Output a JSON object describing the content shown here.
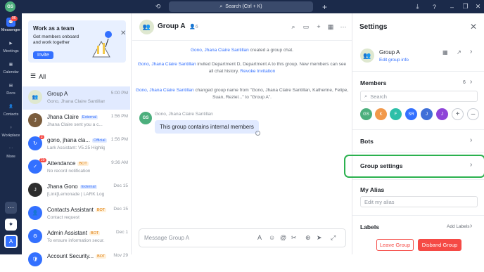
{
  "topbar": {
    "avatar": "GS",
    "search": "Search (Ctrl + K)"
  },
  "nav": {
    "messenger": "Messenger",
    "messenger_badge": "96",
    "meetings": "Meetings",
    "calendar": "Calendar",
    "docs": "Docs",
    "contacts": "Contacts",
    "workplace": "Workplace",
    "more": "More",
    "bottom_avatar": "A"
  },
  "banner": {
    "title": "Work as a team",
    "subtitle": "Get members onboard and work together",
    "invite": "Invite"
  },
  "list_filter": "All",
  "chats": [
    {
      "name": "Group A",
      "time": "5:00 PM",
      "sub": "Gono, Jhana Claire Santillan"
    },
    {
      "name": "Jhana Claire",
      "tag": "External",
      "time": "1:56 PM",
      "sub": "Jhana Claire sent you a c..."
    },
    {
      "name": "gono, jhana cla...",
      "tag": "Official",
      "time": "1:56 PM",
      "sub": "Lark Assistant: V5.25 Highlig...",
      "badge": "2"
    },
    {
      "name": "Attendance",
      "tag": "BOT",
      "time": "9:36 AM",
      "sub": "No record notification",
      "badge": "29"
    },
    {
      "name": "Jhana Gono",
      "tag": "External",
      "time": "Dec 15",
      "sub": "[Link]Lemonade | LARK Log ..."
    },
    {
      "name": "Contacts Assistant",
      "tag": "BOT",
      "time": "Dec 15",
      "sub": "Contact request"
    },
    {
      "name": "Admin Assistant",
      "tag": "BOT",
      "time": "Dec 1",
      "sub": "To ensure information secur..."
    },
    {
      "name": "Account Security...",
      "tag": "BOT",
      "time": "Nov 29",
      "sub": ""
    }
  ],
  "chat": {
    "title": "Group A",
    "member_count": "6",
    "sys1_link": "Gono, Jhana Claire Santillan",
    "sys1_text": " created a group chat.",
    "sys2_link": "Gono, Jhana Claire Santillan",
    "sys2_text_a": " invited Department D, Department A to this group. New members can see",
    "sys2_text_b": "all chat history. ",
    "sys2_revoke": "Revoke Invitation",
    "sys3_link": "Gono, Jhana Claire Santillan",
    "sys3_text_a": " changed group name from \"Gono, Jhana Claire Santillan, Katherine, Felipe,",
    "sys3_text_b": "Suan, Reziel...\" to \"Group A\".",
    "msg_avatar": "GS",
    "msg_sender": "Gono, Jhana Claire Santillan",
    "msg_text": "This group contains internal members",
    "composer_placeholder": "Message Group A"
  },
  "settings": {
    "title": "Settings",
    "group_name": "Group A",
    "edit_info": "Edit group info",
    "members_label": "Members",
    "members_count": "6",
    "members_search": "Search",
    "member_avatars": [
      {
        "initials": "GS",
        "color": "#4caf7d"
      },
      {
        "initials": "K",
        "color": "#f2994a"
      },
      {
        "initials": "F",
        "color": "#2dbfa8"
      },
      {
        "initials": "SR",
        "color": "#3370ff"
      },
      {
        "initials": "J",
        "color": "#3f6fd8"
      },
      {
        "initials": "J",
        "color": "#8e44d8"
      }
    ],
    "bots_label": "Bots",
    "group_settings_label": "Group settings",
    "alias_label": "My Alias",
    "alias_placeholder": "Edit my alias",
    "labels_label": "Labels",
    "add_labels": "Add Labels",
    "leave": "Leave Group",
    "disband": "Disband Group"
  }
}
